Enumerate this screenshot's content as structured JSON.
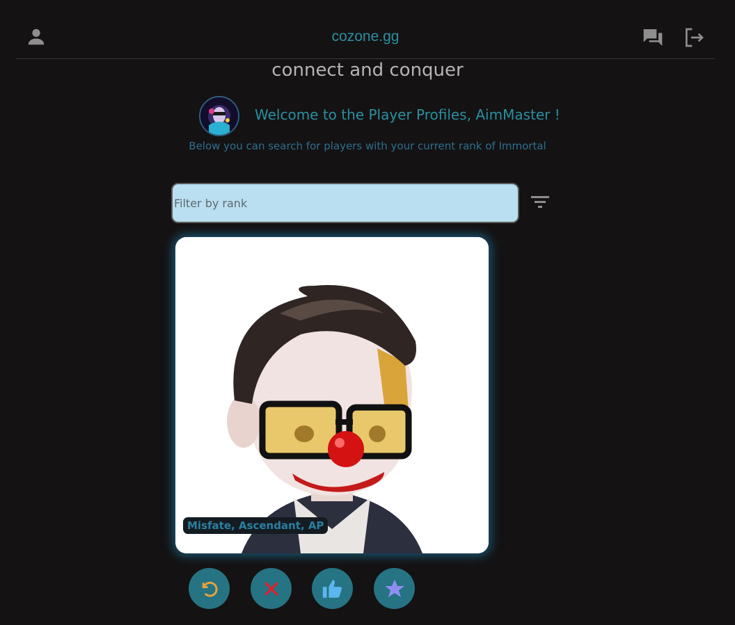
{
  "header": {
    "brand": "cozone.gg",
    "tagline": "connect and conquer",
    "icons": [
      "person-icon",
      "chat-icon",
      "logout-icon"
    ]
  },
  "welcome": {
    "title": "Welcome to the Player Profiles, AimMaster !",
    "subtitle": "Below you can search for players with your current rank of Immortal"
  },
  "filter": {
    "placeholder": "Filter by rank",
    "value": ""
  },
  "card": {
    "caption": "Misfate, Ascendant, AP"
  },
  "actions": [
    {
      "name": "undo-button",
      "icon": "undo-icon",
      "color": "#e6a23c"
    },
    {
      "name": "reject-button",
      "icon": "close-icon",
      "color": "#e0202a"
    },
    {
      "name": "like-button",
      "icon": "thumbs-up-icon",
      "color": "#5ab8ee"
    },
    {
      "name": "superlike-button",
      "icon": "star-icon",
      "color": "#8e8ff0"
    }
  ],
  "colors": {
    "background": "#141213",
    "accent": "#2a8fa0",
    "input_bg": "#b9dff0",
    "button_bg": "#267383"
  }
}
